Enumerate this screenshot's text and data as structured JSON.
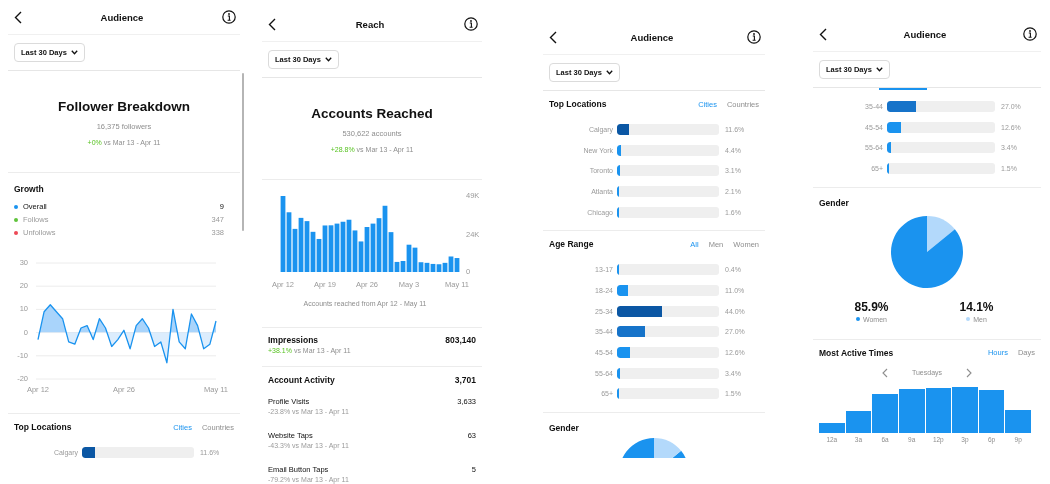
{
  "screens": [
    {
      "title": "Audience",
      "range": "Last 30 Days",
      "scrollbar": true,
      "sections": [
        {
          "kind": "summary",
          "heading": "Follower Breakdown",
          "subtitle": "16,375 followers",
          "change": "+0%",
          "comparison": "vs Mar 13 - Apr 11"
        },
        {
          "kind": "growth",
          "title": "Growth",
          "legend": [
            {
              "label": "Overall",
              "value": "9",
              "color": "#1a93ef",
              "selected": true
            },
            {
              "label": "Follows",
              "value": "347",
              "color": "#5fc33b",
              "selected": false
            },
            {
              "label": "Unfollows",
              "value": "338",
              "color": "#ed4956",
              "selected": false
            }
          ]
        },
        {
          "kind": "line_chart",
          "chart_data": {
            "type": "line",
            "categories": [
              "Apr 12",
              null,
              null,
              null,
              null,
              null,
              null,
              null,
              null,
              null,
              null,
              null,
              null,
              null,
              "Apr 26",
              null,
              null,
              null,
              null,
              null,
              null,
              null,
              null,
              null,
              null,
              null,
              null,
              null,
              null,
              "May 11"
            ],
            "ylim": [
              -20,
              30
            ],
            "yticks": [
              -20,
              -10,
              0,
              10,
              20,
              30
            ],
            "grid": true,
            "series": [
              {
                "color": "#1a93ef",
                "values": [
                  -3,
                  9,
                  12,
                  9,
                  6,
                  -4,
                  -5,
                  2,
                  3,
                  -3,
                  6,
                  2,
                  -6,
                  -3,
                  1,
                  -7,
                  3,
                  6,
                  2,
                  -6,
                  -4,
                  -13,
                  10,
                  -4,
                  -7,
                  8,
                  3,
                  -7,
                  -5,
                  5
                ]
              }
            ]
          }
        },
        {
          "kind": "bars",
          "title": "Top Locations",
          "tabs": [
            {
              "label": "Cities",
              "selected": true
            },
            {
              "label": "Countries",
              "selected": false
            }
          ],
          "rows": [
            {
              "label": "Calgary",
              "level": 0.116,
              "reading": "11.6%",
              "color": "#0b57a4"
            }
          ]
        }
      ]
    },
    {
      "title": "Reach",
      "range": "Last 30 Days",
      "sections": [
        {
          "kind": "summary",
          "heading": "Accounts Reached",
          "subtitle": "530,622 accounts",
          "change": "+28.8%",
          "comparison": "vs Mar 13 - Apr 11"
        },
        {
          "kind": "bar_chart",
          "caption": "Accounts reached from Apr 12 - May 11",
          "chart_data": {
            "type": "bar",
            "categories": [
              "Apr 12",
              null,
              null,
              null,
              null,
              null,
              null,
              "Apr 19",
              null,
              null,
              null,
              null,
              null,
              null,
              "Apr 26",
              null,
              null,
              null,
              null,
              null,
              null,
              "May 3",
              null,
              null,
              null,
              null,
              null,
              null,
              null,
              "May 11"
            ],
            "ylim": [
              0,
              49000
            ],
            "yticks": [
              {
                "value": 0,
                "label": "0"
              },
              {
                "value": 24000,
                "label": "24K"
              },
              {
                "value": 49000,
                "label": "49K"
              }
            ],
            "series": [
              {
                "color": "#1a93ef",
                "values": [
                  49000,
                  38500,
                  27800,
                  34900,
                  32800,
                  25900,
                  21300,
                  30000,
                  30100,
                  31200,
                  32400,
                  33700,
                  26800,
                  19700,
                  29000,
                  31200,
                  34700,
                  42700,
                  25700,
                  6500,
                  7100,
                  17600,
                  15700,
                  6300,
                  5900,
                  5200,
                  5000,
                  5900,
                  10000,
                  9000
                ]
              }
            ]
          }
        },
        {
          "kind": "metric",
          "title": "Impressions",
          "value": "803,140",
          "change": "+38.1%",
          "comparison": "vs Mar 13 - Apr 11"
        },
        {
          "kind": "activity",
          "title": "Account Activity",
          "value": "3,701",
          "items": [
            {
              "label": "Profile Visits",
              "note": "-23.8% vs Mar 13 - Apr 11",
              "value": "3,633"
            },
            {
              "label": "Website Taps",
              "note": "-43.3% vs Mar 13 - Apr 11",
              "value": "63"
            },
            {
              "label": "Email Button Taps",
              "note": "-79.2% vs Mar 13 - Apr 11",
              "value": "5"
            }
          ]
        }
      ]
    },
    {
      "title": "Audience",
      "range": "Last 30 Days",
      "sections": [
        {
          "kind": "bars",
          "title": "Top Locations",
          "tabs": [
            {
              "label": "Cities",
              "selected": true
            },
            {
              "label": "Countries",
              "selected": false
            }
          ],
          "rows": [
            {
              "label": "Calgary",
              "level": 0.116,
              "reading": "11.6%",
              "color": "#0b57a4"
            },
            {
              "label": "New York",
              "level": 0.044,
              "reading": "4.4%",
              "color": "#1a93ef"
            },
            {
              "label": "Toronto",
              "level": 0.031,
              "reading": "3.1%",
              "color": "#1a93ef"
            },
            {
              "label": "Atlanta",
              "level": 0.021,
              "reading": "2.1%",
              "color": "#1a93ef"
            },
            {
              "label": "Chicago",
              "level": 0.016,
              "reading": "1.6%",
              "color": "#1a93ef"
            }
          ]
        },
        {
          "kind": "bars",
          "title": "Age Range",
          "tabs": [
            {
              "label": "All",
              "selected": true
            },
            {
              "label": "Men",
              "selected": false
            },
            {
              "label": "Women",
              "selected": false
            }
          ],
          "rows": [
            {
              "label": "13-17",
              "level": 0.004,
              "reading": "0.4%",
              "color": "#1a93ef"
            },
            {
              "label": "18-24",
              "level": 0.11,
              "reading": "11.0%",
              "color": "#1a93ef"
            },
            {
              "label": "25-34",
              "level": 0.44,
              "reading": "44.0%",
              "color": "#0b57a4"
            },
            {
              "label": "35-44",
              "level": 0.27,
              "reading": "27.0%",
              "color": "#1673c9"
            },
            {
              "label": "45-54",
              "level": 0.126,
              "reading": "12.6%",
              "color": "#1a93ef"
            },
            {
              "label": "55-64",
              "level": 0.034,
              "reading": "3.4%",
              "color": "#1a93ef"
            },
            {
              "label": "65+",
              "level": 0.015,
              "reading": "1.5%",
              "color": "#1a93ef"
            }
          ]
        },
        {
          "kind": "pie_peek",
          "title": "Gender"
        }
      ]
    },
    {
      "title": "Audience",
      "range": "Last 30 Days",
      "sections": [
        {
          "kind": "bars",
          "rows": [
            {
              "label": "35-44",
              "level": 0.27,
              "reading": "27.0%",
              "color": "#1673c9"
            },
            {
              "label": "45-54",
              "level": 0.126,
              "reading": "12.6%",
              "color": "#1a93ef"
            },
            {
              "label": "55-64",
              "level": 0.034,
              "reading": "3.4%",
              "color": "#1a93ef"
            },
            {
              "label": "65+",
              "level": 0.015,
              "reading": "1.5%",
              "color": "#1a93ef"
            }
          ]
        },
        {
          "kind": "pie",
          "title": "Gender",
          "chart_data": {
            "type": "pie",
            "values": [
              85.9,
              14.1
            ]
          },
          "legend": [
            {
              "value": "85.9%",
              "label": "Women",
              "color": "#1a93ef"
            },
            {
              "value": "14.1%",
              "label": "Men",
              "color": "#b3d9fb"
            }
          ]
        },
        {
          "kind": "active_times",
          "title": "Most Active Times",
          "tabs": [
            {
              "label": "Hours",
              "selected": true
            },
            {
              "label": "Days",
              "selected": false
            }
          ],
          "day": "Tuesdays",
          "labels": [
            "12a",
            "3a",
            "6a",
            "9a",
            "12p",
            "3p",
            "6p",
            "9p"
          ]
        }
      ]
    }
  ]
}
